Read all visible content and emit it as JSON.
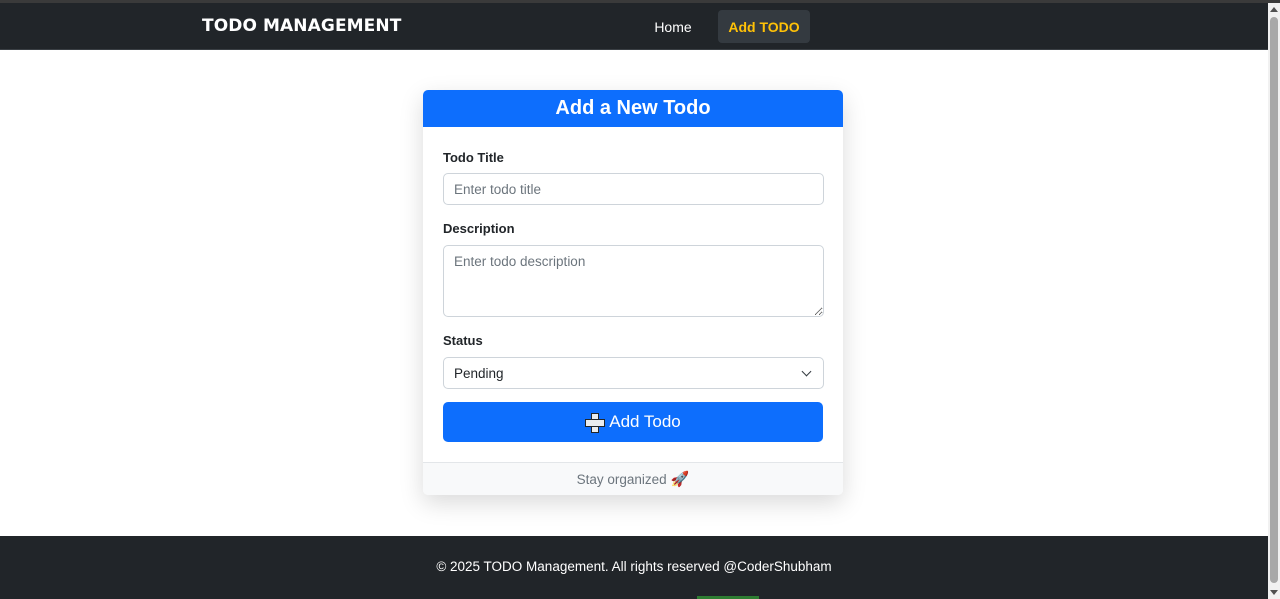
{
  "navbar": {
    "brand": "TODO MANAGEMENT",
    "links": [
      {
        "label": "Home",
        "active": false
      },
      {
        "label": "Add TODO",
        "active": true
      }
    ]
  },
  "form": {
    "header": "Add a New Todo",
    "title_label": "Todo Title",
    "title_placeholder": "Enter todo title",
    "title_value": "",
    "description_label": "Description",
    "description_placeholder": "Enter todo description",
    "description_value": "",
    "status_label": "Status",
    "status_selected": "Pending",
    "submit_label": "Add Todo",
    "submit_icon": "plus-icon",
    "footer_text": "Stay organized",
    "footer_icon": "rocket-icon"
  },
  "footer": {
    "text": "© 2025 TODO Management. All rights reserved @CoderShubham"
  },
  "colors": {
    "navbar_bg": "#212529",
    "accent": "#0d6efd",
    "active_link": "#ffc107"
  }
}
